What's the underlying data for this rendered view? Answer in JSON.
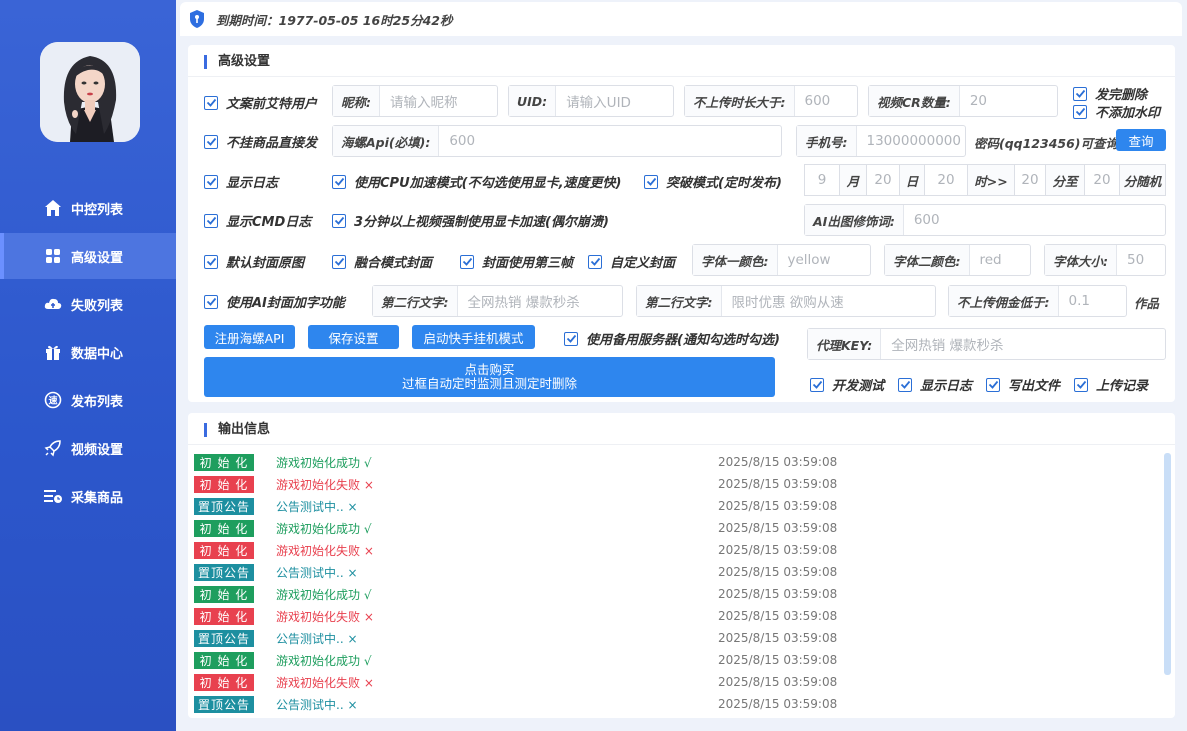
{
  "colors": {
    "accent": "#2e86ee",
    "sidebar": "#2c57cc",
    "green": "#1e9e5e",
    "red": "#e8414f",
    "teal": "#1d8fa0"
  },
  "topbar": {
    "expire": "到期时间：1977-05-05 16时25分42秒",
    "icon": "shield-icon"
  },
  "sidebar": {
    "items": [
      {
        "label": "中控列表",
        "icon": "home-icon"
      },
      {
        "label": "高级设置",
        "icon": "grid-icon"
      },
      {
        "label": "失败列表",
        "icon": "cloud-icon"
      },
      {
        "label": "数据中心",
        "icon": "gift-icon"
      },
      {
        "label": "发布列表",
        "icon": "speed-icon"
      },
      {
        "label": "视频设置",
        "icon": "rocket-icon"
      },
      {
        "label": "采集商品",
        "icon": "collect-icon"
      }
    ]
  },
  "settings": {
    "title": "高级设置",
    "row1": {
      "mention": "文案前艾特用户",
      "nick_label": "昵称:",
      "nick_ph": "请输入昵称",
      "uid_label": "UID:",
      "uid_ph": "请输入UID",
      "dur_label": "不上传时长大于:",
      "dur_val": "600",
      "cr_label": "视频CR数量:",
      "cr_val": "20",
      "del_after": "发完删除",
      "no_watermark": "不添加水印"
    },
    "row2": {
      "no_goods": "不挂商品直接发",
      "api_label": "海螺Api(必填):",
      "api_val": "600",
      "phone_label": "手机号:",
      "phone_val": "13000000000",
      "pwd_text": "密码(qq123456)可查询",
      "query_btn": "查询"
    },
    "row3": {
      "show_log": "显示日志",
      "cpu_mode": "使用CPU加速模式(不勾选使用显卡,速度更快)",
      "break_mode": "突破模式(定时发布)",
      "month_val": "9",
      "month_l": "月",
      "day_val": "20",
      "day_l": "日",
      "hour_val": "20",
      "hour_l": "时>>",
      "min_from": "20",
      "min_l": "分至",
      "min_to": "20",
      "rand_l": "分随机"
    },
    "row4": {
      "show_cmd": "显示CMD日志",
      "gpu_force": "3分钟以上视频强制使用显卡加速(偶尔崩溃)",
      "ai_label": "AI出图修饰词:",
      "ai_val": "600"
    },
    "row5": {
      "default_cover": "默认封面原图",
      "fusion_cover": "融合模式封面",
      "third_frame": "封面使用第三帧",
      "custom_cover": "自定义封面",
      "font1_label": "字体一颜色:",
      "font1_val": "yellow",
      "font2_label": "字体二颜色:",
      "font2_val": "red",
      "size_label": "字体大小:",
      "size_val": "50"
    },
    "row6": {
      "ai_cover": "使用AI封面加字功能",
      "line2a_label": "第二行文字:",
      "line2a_val": "全网热销 爆款秒杀",
      "line2b_label": "第二行文字:",
      "line2b_val": "限时优惠 欲购从速",
      "comm_label": "不上传佣金低于:",
      "comm_val": "0.1",
      "works": "作品"
    },
    "row7": {
      "reg_btn": "注册海螺API",
      "save_btn": "保存设置",
      "start_btn": "启动快手挂机模式",
      "backup": "使用备用服务器(通知勾选时勾选)",
      "proxy_label": "代理KEY:",
      "proxy_ph": "全网热销 爆款秒杀"
    },
    "buy": {
      "line1": "点击购买",
      "line2": "过框自动定时监测且测定时删除"
    },
    "row8": {
      "dev_test": "开发测试",
      "show_log": "显示日志",
      "write_file": "写出文件",
      "upload_rec": "上传记录"
    }
  },
  "output": {
    "title": "输出信息",
    "logs": [
      {
        "tag": "初 始 化",
        "type": "green",
        "msg": "游戏初始化成功 √",
        "time": "2025/8/15 03:59:08"
      },
      {
        "tag": "初 始 化",
        "type": "red",
        "msg": "游戏初始化失败 ×",
        "time": "2025/8/15 03:59:08"
      },
      {
        "tag": "置顶公告",
        "type": "teal",
        "msg": "公告测试中.. ×",
        "time": "2025/8/15 03:59:08"
      },
      {
        "tag": "初 始 化",
        "type": "green",
        "msg": "游戏初始化成功 √",
        "time": "2025/8/15 03:59:08"
      },
      {
        "tag": "初 始 化",
        "type": "red",
        "msg": "游戏初始化失败 ×",
        "time": "2025/8/15 03:59:08"
      },
      {
        "tag": "置顶公告",
        "type": "teal",
        "msg": "公告测试中.. ×",
        "time": "2025/8/15 03:59:08"
      },
      {
        "tag": "初 始 化",
        "type": "green",
        "msg": "游戏初始化成功 √",
        "time": "2025/8/15 03:59:08"
      },
      {
        "tag": "初 始 化",
        "type": "red",
        "msg": "游戏初始化失败 ×",
        "time": "2025/8/15 03:59:08"
      },
      {
        "tag": "置顶公告",
        "type": "teal",
        "msg": "公告测试中.. ×",
        "time": "2025/8/15 03:59:08"
      },
      {
        "tag": "初 始 化",
        "type": "green",
        "msg": "游戏初始化成功 √",
        "time": "2025/8/15 03:59:08"
      },
      {
        "tag": "初 始 化",
        "type": "red",
        "msg": "游戏初始化失败 ×",
        "time": "2025/8/15 03:59:08"
      },
      {
        "tag": "置顶公告",
        "type": "teal",
        "msg": "公告测试中.. ×",
        "time": "2025/8/15 03:59:08"
      }
    ]
  }
}
